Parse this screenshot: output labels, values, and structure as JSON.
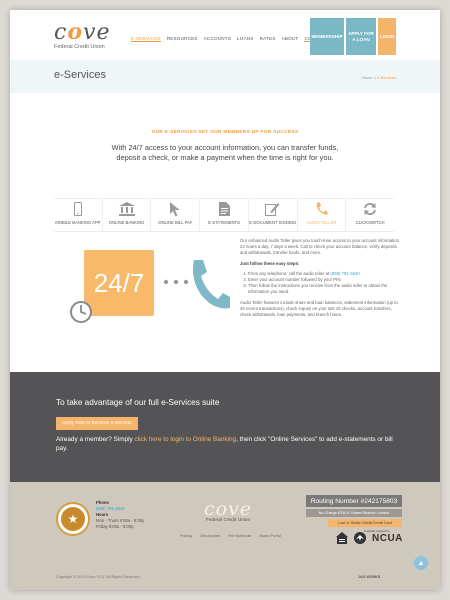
{
  "brand": {
    "logo_word_pre": "c",
    "logo_word_o": "o",
    "logo_word_post": "ve",
    "logo_sub": "Federal Credit Union",
    "accent": "#f39b3d",
    "teal": "#7ab8c5"
  },
  "nav": {
    "items": [
      "E-SERVICES",
      "RESOURCES",
      "ACCOUNTS",
      "LOANS",
      "RATES",
      "ABOUT",
      "CONTACT US"
    ],
    "membership": "MEMBERSHIP",
    "apply_line1": "APPLY FOR",
    "apply_line2": "A LOAN",
    "login": "LOGIN"
  },
  "page": {
    "title": "e-Services",
    "crumb_home": "Home",
    "crumb_sep": "»",
    "crumb_current": "e-Services",
    "tagline": "OUR E-SERVICES SET OUR MEMBERS UP FOR SUCCESS",
    "intro": "With 24/7 access to your account information, you can transfer funds, deposit a check, or make a payment when the time is right for you."
  },
  "services": [
    {
      "label": "MOBILE BANKING APP",
      "icon": "mobile-icon"
    },
    {
      "label": "ONLINE BANKING",
      "icon": "bank-icon"
    },
    {
      "label": "ONLINE BILL PAY",
      "icon": "cursor-icon"
    },
    {
      "label": "E-STATEMENTS",
      "icon": "document-icon"
    },
    {
      "label": "E-DOCUMENT SIGNING",
      "icon": "sign-icon"
    },
    {
      "label": "AUDIO TELLER",
      "icon": "phone-icon"
    },
    {
      "label": "CLICKSWITCH",
      "icon": "switch-icon"
    }
  ],
  "audio": {
    "illus_text": "24/7",
    "p1": "Our enhanced Audio Teller gives you touch-tone access to your account information 24 hours a day, 7 days a week. Call to check your account balance, verify deposits and withdrawals, transfer funds, and more.",
    "steps_title": "Just follow these easy steps:",
    "step1_pre": "From any telephone, call the audio teller at ",
    "step1_phone": "(859) 781-5640",
    "step2": "Enter your account number followed by your PIN.",
    "step3": "Then follow the instructions you receive from the audio teller to obtain the information you need.",
    "p2": "Audio Teller features include share and loan balances, statement information (up to 40 recent transactions), check inquiry on your last 10 checks, account transfers, check withdrawals, loan payments, and branch hours."
  },
  "cta": {
    "heading": "To take advantage of our full e-Services suite",
    "button": "Apply Now to Become a Member",
    "text_pre": "Already a member? Simply ",
    "link": "click here to login to Online Banking",
    "text_post": ", then click \"Online Services\" to add e-statements or bill pay."
  },
  "footer": {
    "phone_label": "Phone",
    "phone": "(859) 781-5640",
    "hours_label": "Hours",
    "hours1": "Mon - Thurs 9:00a - 5:00p",
    "hours2": "Friday 9:00a - 6:00p",
    "links": [
      "Privacy",
      "Disclosures",
      "Fee Schedule",
      "Board Portal"
    ],
    "routing": "Routing Number #242175803",
    "no_charge": "No Charge ATM & Shared Branch Locator",
    "debit": "Lost or Stolen Debit/Credit Card",
    "ncua_caption": "Federally Insured by",
    "ncua": "NCUA",
    "copyright": "Copyright © 2019 Cove FCU. All Rights Reserved.",
    "maker": "JAG WORKS"
  }
}
